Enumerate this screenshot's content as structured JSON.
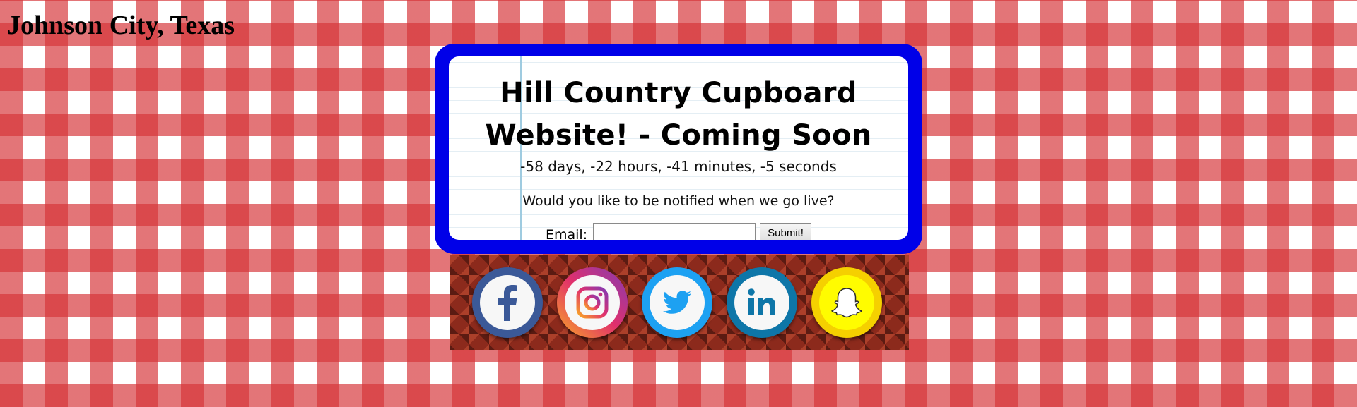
{
  "header": {
    "city": "Johnson City, Texas"
  },
  "card": {
    "headline": "Hill Country Cupboard Website! - Coming Soon",
    "countdown": "-58 days, -22 hours, -41 minutes, -5 seconds",
    "notify_prompt": "Would you like to be notified when we go live?"
  },
  "form": {
    "email_label": "Email:",
    "email_value": "",
    "submit_label": "Submit!"
  },
  "social": [
    {
      "icon": "facebook-icon",
      "color": "#3b5998"
    },
    {
      "icon": "instagram-icon",
      "color": "#c13584"
    },
    {
      "icon": "twitter-icon",
      "color": "#1da1f2"
    },
    {
      "icon": "linkedin-icon",
      "color": "#0e76a8"
    },
    {
      "icon": "snapchat-icon",
      "color": "#fffc00"
    }
  ],
  "colors": {
    "frame": "#0000e8",
    "gingham": "#d63438"
  }
}
